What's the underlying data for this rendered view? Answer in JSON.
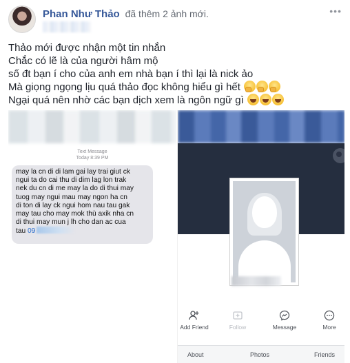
{
  "post": {
    "author": "Phan Như Thảo",
    "action": "đã thêm 2 ảnh mới.",
    "options_icon": "more-options-icon",
    "lines": [
      "Thảo mới được nhận một tin nhắn",
      "Chắc có lẽ là của người hâm mộ",
      "số đt bạn í cho của anh em nhà bạn í thì lại là nick ảo",
      "Mà giọng ngọng lịu quá thảo đọc không hiểu gì hết",
      "Ngại quá nên nhờ các bạn dịch xem là ngôn ngữ gì"
    ],
    "emoji_line4": "thinking-face-emoji",
    "emoji_line5": "laughing-face-emoji"
  },
  "sms": {
    "title": "Text Message",
    "date": "Today 8:39 PM",
    "lines": [
      "may la cn di di lam gai lay trai giut ck",
      "ngui ta do cai thu di dim lag lon trak",
      "nek du cn di me may la do di thui may",
      "tuog may ngui mau may ngon ha cn",
      "di ton di lay ck ngui hom nau tau gak",
      "may tau cho may mok thù axik nha cn",
      "di thui may mun j lh cho dan ac cua"
    ],
    "last_prefix": "tau",
    "phone_visible": "09"
  },
  "profile": {
    "actions": [
      {
        "label": "Add Friend",
        "icon": "add-friend-icon",
        "glyph": "👤",
        "enabled": true
      },
      {
        "label": "Follow",
        "icon": "follow-icon",
        "glyph": "▣",
        "enabled": false
      },
      {
        "label": "Message",
        "icon": "messenger-icon",
        "glyph": "💬",
        "enabled": true
      },
      {
        "label": "More",
        "icon": "more-icon",
        "glyph": "⋯",
        "enabled": true
      }
    ],
    "tabs": [
      "About",
      "Photos",
      "Friends"
    ]
  }
}
